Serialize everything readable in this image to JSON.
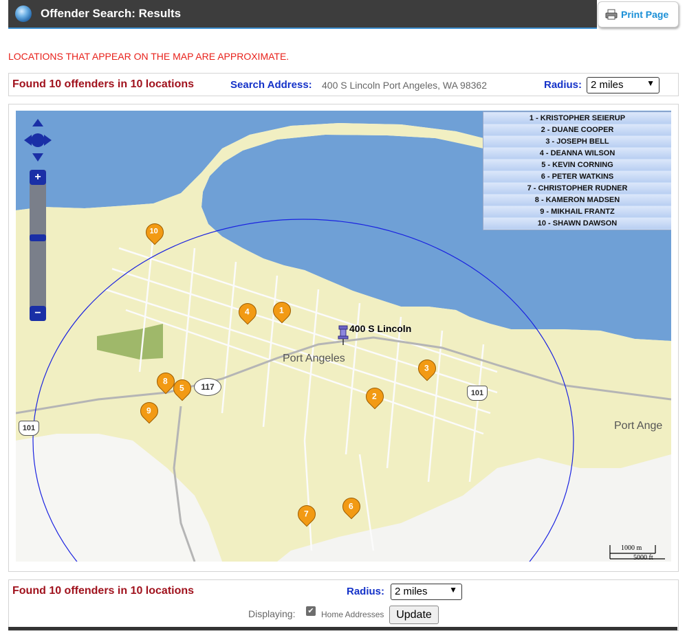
{
  "header": {
    "title": "Offender Search: Results",
    "print_label": "Print Page"
  },
  "warning": "LOCATIONS THAT APPEAR ON THE MAP ARE APPROXIMATE.",
  "summary": {
    "found_text": "Found 10 offenders in 10 locations",
    "search_address_label": "Search Address:",
    "search_address_value": "400 S Lincoln Port Angeles, WA 98362",
    "radius_label": "Radius:",
    "radius_value": "2 miles"
  },
  "map": {
    "legend": [
      "1 - KRISTOPHER SEIERUP",
      "2 - DUANE COOPER",
      "3 - JOSEPH BELL",
      "4 - DEANNA WILSON",
      "5 - KEVIN CORNING",
      "6 - PETER WATKINS",
      "7 - CHRISTOPHER RUDNER",
      "8 - KAMERON MADSEN",
      "9 - MIKHAIL FRANTZ",
      "10 - SHAWN DAWSON"
    ],
    "pins": [
      "1",
      "2",
      "3",
      "4",
      "5",
      "6",
      "7",
      "8",
      "9",
      "10"
    ],
    "center_label": "400 S Lincoln",
    "city_label": "Port Angeles",
    "city_label_right": "Port Ange",
    "route_117": "117",
    "route_101_a": "101",
    "route_101_b": "101",
    "scale_metric": "1000 m",
    "scale_imperial": "5000 ft",
    "colors": {
      "water": "#6fa0d6",
      "land": "#f1efc2",
      "radius_circle": "#1a22e0",
      "pin": "#f29a14",
      "park": "#9fb86a"
    }
  },
  "bottom": {
    "found_text": "Found 10 offenders in 10 locations",
    "radius_label": "Radius:",
    "radius_value": "2 miles",
    "displaying_label": "Displaying:",
    "checkbox_checked": "✔",
    "home_label": "Home Addresses",
    "update_label": "Update"
  }
}
